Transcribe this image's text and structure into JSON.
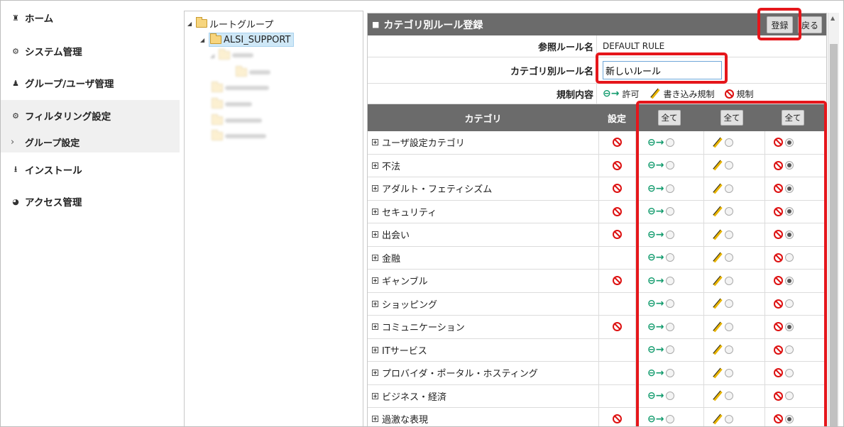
{
  "nav": {
    "items": [
      {
        "label": "ホーム",
        "icon": "home-icon"
      },
      {
        "label": "システム管理",
        "icon": "gear-icon"
      },
      {
        "label": "グループ/ユーザ管理",
        "icon": "users-icon"
      },
      {
        "label": "フィルタリング設定",
        "icon": "gears-icon"
      },
      {
        "label": "インストール",
        "icon": "download-icon"
      },
      {
        "label": "アクセス管理",
        "icon": "pie-chart-icon"
      }
    ],
    "sub_item": "グループ設定"
  },
  "tree": {
    "root": "ルートグループ",
    "selected": "ALSI_SUPPORT"
  },
  "panel": {
    "title": "カテゴリ別ルール登録",
    "register_button": "登録",
    "back_button": "戻る",
    "ref_rule_label": "参照ルール名",
    "ref_rule_value": "DEFAULT RULE",
    "rule_name_label": "カテゴリ別ルール名",
    "rule_name_value": "新しいルール",
    "restriction_label": "規制内容",
    "legend": {
      "permit": "許可",
      "write": "書き込み規制",
      "block": "規制"
    }
  },
  "table": {
    "col_category": "カテゴリ",
    "col_setting": "設定",
    "all_label": "全て",
    "rows": [
      {
        "name": "ユーザ設定カテゴリ",
        "blocked": true,
        "selected": "block"
      },
      {
        "name": "不法",
        "blocked": true,
        "selected": "block"
      },
      {
        "name": "アダルト・フェティシズム",
        "blocked": true,
        "selected": "block"
      },
      {
        "name": "セキュリティ",
        "blocked": true,
        "selected": "block"
      },
      {
        "name": "出会い",
        "blocked": true,
        "selected": "block"
      },
      {
        "name": "金融",
        "blocked": false,
        "selected": "none"
      },
      {
        "name": "ギャンブル",
        "blocked": true,
        "selected": "block"
      },
      {
        "name": "ショッピング",
        "blocked": false,
        "selected": "none"
      },
      {
        "name": "コミュニケーション",
        "blocked": true,
        "selected": "block"
      },
      {
        "name": "ITサービス",
        "blocked": false,
        "selected": "none"
      },
      {
        "name": "プロバイダ・ポータル・ホスティング",
        "blocked": false,
        "selected": "none"
      },
      {
        "name": "ビジネス・経済",
        "blocked": false,
        "selected": "none"
      },
      {
        "name": "過激な表現",
        "blocked": true,
        "selected": "block"
      }
    ]
  },
  "colors": {
    "header": "#6b6b6b",
    "highlight": "#e5161b",
    "permit": "#129b6d",
    "block": "#dd1111"
  }
}
